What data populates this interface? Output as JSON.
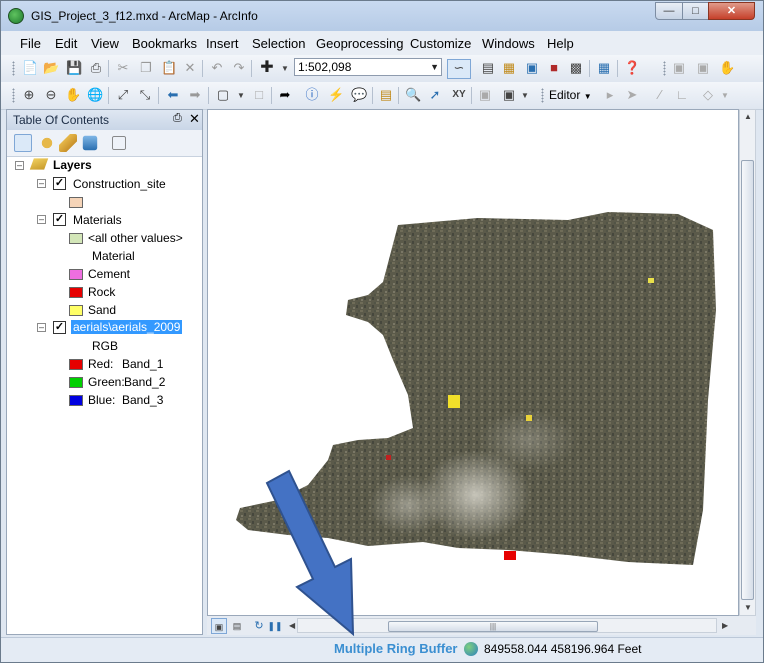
{
  "window": {
    "title": "GIS_Project_3_f12.mxd - ArcMap - ArcInfo"
  },
  "menu": [
    "File",
    "Edit",
    "View",
    "Bookmarks",
    "Insert",
    "Selection",
    "Geoprocessing",
    "Customize",
    "Windows",
    "Help"
  ],
  "toolbar": {
    "scale_value": "1:502,098",
    "editor_label": "Editor"
  },
  "toc": {
    "title": "Table Of Contents",
    "root": "Layers",
    "layers": [
      {
        "name": "Construction_site",
        "checked": true,
        "legend": [
          {
            "label": "",
            "color": "#f5d4b8"
          }
        ]
      },
      {
        "name": "Materials",
        "checked": true,
        "legend": [
          {
            "label": "<all other values>",
            "color": "#d3e6b8"
          },
          {
            "label": "Material",
            "color": ""
          },
          {
            "label": "Cement",
            "color": "#ee6ee0"
          },
          {
            "label": "Rock",
            "color": "#e60000"
          },
          {
            "label": "Sand",
            "color": "#ffff66"
          }
        ]
      },
      {
        "name": "aerials\\aerials_2009",
        "checked": true,
        "selected": true,
        "legend": [
          {
            "label": "RGB",
            "color": ""
          },
          {
            "label": "Red:",
            "band": "Band_1",
            "color": "#e60000"
          },
          {
            "label": "Green:",
            "band": "Band_2",
            "color": "#00d000"
          },
          {
            "label": "Blue:",
            "band": "Band_3",
            "color": "#0000e0"
          }
        ]
      }
    ]
  },
  "status": {
    "tool_name": "Multiple Ring Buffer",
    "coordinates": "849558.044  458196.964 Feet"
  },
  "colors": {
    "annotation_arrow": "#4472c4",
    "status_tool": "#3b8fd1"
  }
}
